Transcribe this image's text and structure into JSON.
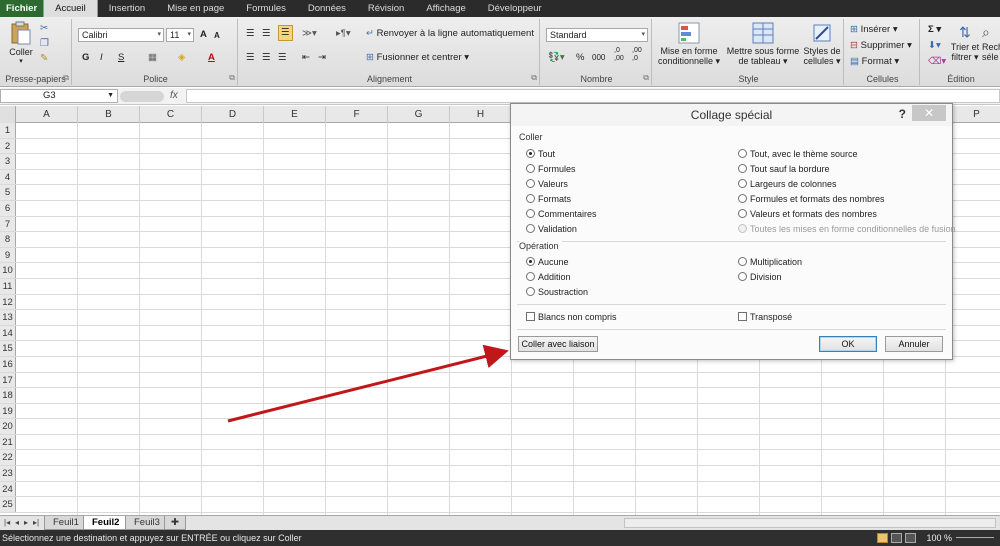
{
  "menubar": {
    "tabs": [
      "Fichier",
      "Accueil",
      "Insertion",
      "Mise en page",
      "Formules",
      "Données",
      "Révision",
      "Affichage",
      "Développeur"
    ],
    "active": "Accueil"
  },
  "ribbon": {
    "clipboard": {
      "paste_label": "Coller",
      "group_label": "Presse-papiers"
    },
    "font": {
      "font_name": "Calibri",
      "font_size": "11",
      "group_label": "Police",
      "bold": "G",
      "italic": "I",
      "underline": "S",
      "grow": "A",
      "shrink": "A"
    },
    "alignment": {
      "wrap_label": "Renvoyer à la ligne automatiquement",
      "merge_label": "Fusionner et centrer",
      "group_label": "Alignement"
    },
    "number": {
      "format": "Standard",
      "group_label": "Nombre",
      "percent": "%",
      "thousands": "000",
      "inc_dec": ",0 ,00",
      "dec_dec": ",00 ,0"
    },
    "styles": {
      "cond_format": [
        "Mise en forme",
        "conditionnelle"
      ],
      "table_format": [
        "Mettre sous forme",
        "de tableau"
      ],
      "cell_styles": [
        "Styles de",
        "cellules"
      ],
      "group_label": "Style"
    },
    "cells": {
      "insert": "Insérer",
      "delete": "Supprimer",
      "format": "Format",
      "group_label": "Cellules"
    },
    "editing": {
      "sort_filter": [
        "Trier et",
        "filtrer"
      ],
      "find_select": [
        "Rech",
        "séle"
      ],
      "group_label": "Édition"
    }
  },
  "formula_bar": {
    "name_box": "G3",
    "fx": "fx",
    "formula": ""
  },
  "grid": {
    "columns": [
      "A",
      "B",
      "C",
      "D",
      "E",
      "F",
      "G",
      "H",
      "I",
      "J",
      "K",
      "L",
      "M",
      "N",
      "O",
      "P"
    ],
    "rows": [
      "1",
      "2",
      "3",
      "4",
      "5",
      "6",
      "7",
      "8",
      "9",
      "10",
      "11",
      "12",
      "13",
      "14",
      "15",
      "16",
      "17",
      "18",
      "19",
      "20",
      "21",
      "22",
      "23",
      "24",
      "25"
    ]
  },
  "sheets": {
    "tabs": [
      "Feuil1",
      "Feuil2",
      "Feuil3"
    ],
    "active": "Feuil2"
  },
  "status": {
    "text": "Sélectionnez une destination et appuyez sur ENTRÉE ou cliquez sur Coller",
    "zoom": "100 %"
  },
  "dialog": {
    "title": "Collage spécial",
    "help": "?",
    "close": "✕",
    "paste_section": "Coller",
    "paste_left": [
      {
        "label": "Tout",
        "selected": true
      },
      {
        "label": "Formules",
        "selected": false
      },
      {
        "label": "Valeurs",
        "selected": false
      },
      {
        "label": "Formats",
        "selected": false
      },
      {
        "label": "Commentaires",
        "selected": false
      },
      {
        "label": "Validation",
        "selected": false
      }
    ],
    "paste_right": [
      {
        "label": "Tout, avec le thème source",
        "disabled": false
      },
      {
        "label": "Tout sauf la bordure",
        "disabled": false
      },
      {
        "label": "Largeurs de colonnes",
        "disabled": false
      },
      {
        "label": "Formules et formats des nombres",
        "disabled": false
      },
      {
        "label": "Valeurs et formats des nombres",
        "disabled": false
      },
      {
        "label": "Toutes les mises en forme conditionnelles de fusion",
        "disabled": true
      }
    ],
    "operation_section": "Opération",
    "op_left": [
      {
        "label": "Aucune",
        "selected": true
      },
      {
        "label": "Addition",
        "selected": false
      },
      {
        "label": "Soustraction",
        "selected": false
      }
    ],
    "op_right": [
      {
        "label": "Multiplication",
        "selected": false
      },
      {
        "label": "Division",
        "selected": false
      }
    ],
    "skip_blanks": "Blancs non compris",
    "transpose": "Transposé",
    "paste_link": "Coller avec liaison",
    "ok": "OK",
    "cancel": "Annuler"
  },
  "annotation": {
    "arrow_color": "#c0171b"
  }
}
